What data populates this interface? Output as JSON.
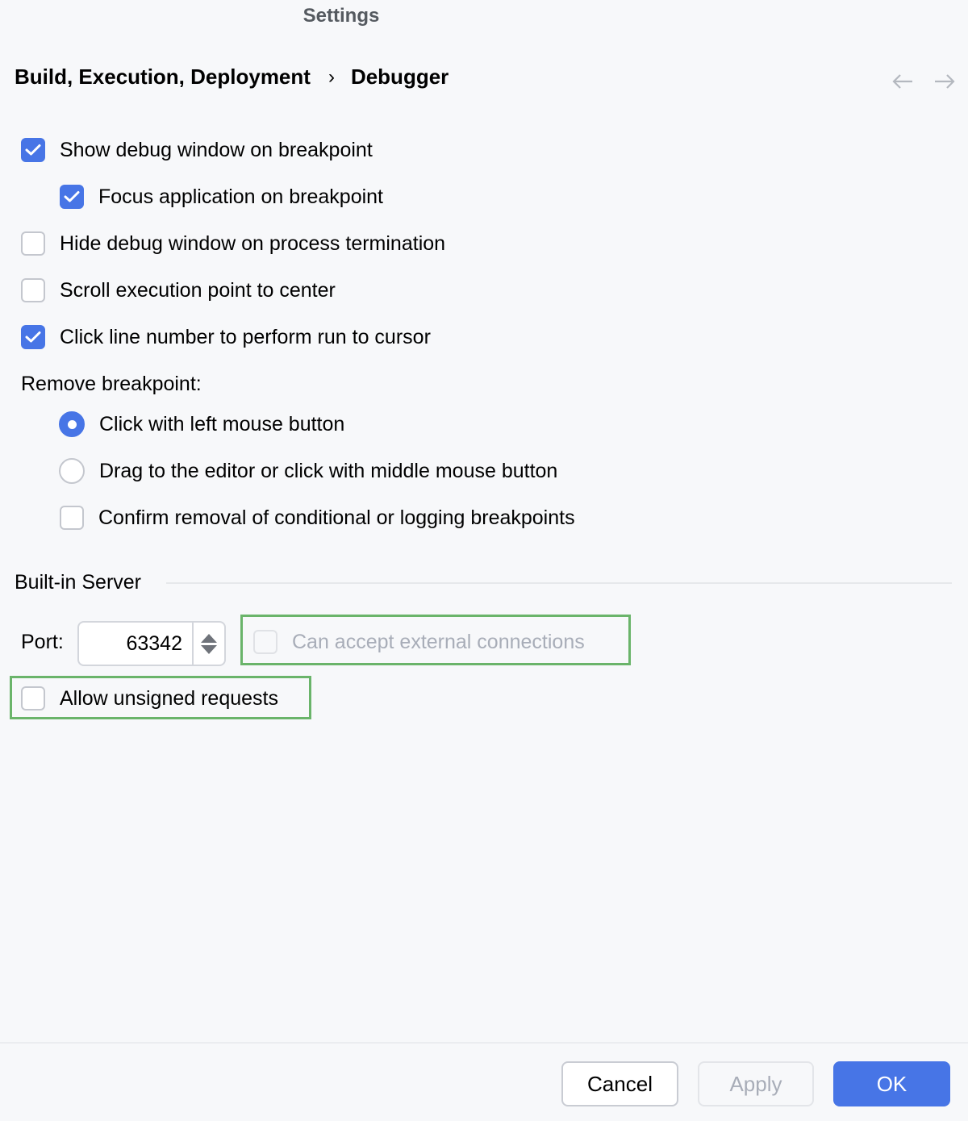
{
  "window": {
    "title": "Settings"
  },
  "breadcrumb": {
    "parent": "Build, Execution, Deployment",
    "separator": "›",
    "current": "Debugger"
  },
  "nav": {
    "back_icon": "arrow-left-icon",
    "forward_icon": "arrow-right-icon"
  },
  "options": {
    "show_debug_window": {
      "label": "Show debug window on breakpoint",
      "checked": true
    },
    "focus_application": {
      "label": "Focus application on breakpoint",
      "checked": true
    },
    "hide_debug_window": {
      "label": "Hide debug window on process termination",
      "checked": false
    },
    "scroll_execution_point": {
      "label": "Scroll execution point to center",
      "checked": false
    },
    "click_line_number": {
      "label": "Click line number to perform run to cursor",
      "checked": true
    }
  },
  "remove_breakpoint": {
    "label": "Remove breakpoint:",
    "radios": [
      {
        "label": "Click with left mouse button",
        "selected": true
      },
      {
        "label": "Drag to the editor or click with middle mouse button",
        "selected": false
      }
    ],
    "confirm": {
      "label": "Confirm removal of conditional or logging breakpoints",
      "checked": false
    }
  },
  "built_in_server": {
    "section_title": "Built-in Server",
    "port_label": "Port:",
    "port_value": "63342",
    "external_connections": {
      "label": "Can accept external connections",
      "checked": false,
      "disabled": true
    },
    "unsigned_requests": {
      "label": "Allow unsigned requests",
      "checked": false
    }
  },
  "highlight_color": "#6ab46a",
  "accent_color": "#4775e6",
  "footer": {
    "cancel": "Cancel",
    "apply": "Apply",
    "ok": "OK"
  }
}
